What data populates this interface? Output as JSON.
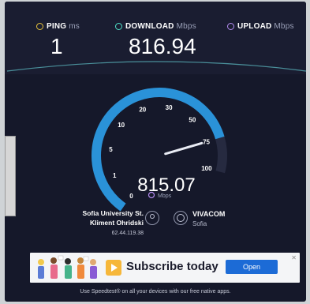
{
  "metrics": {
    "ping": {
      "label": "PING",
      "unit": "ms",
      "value": "1"
    },
    "download": {
      "label": "DOWNLOAD",
      "unit": "Mbps",
      "value": "816.94"
    },
    "upload": {
      "label": "UPLOAD",
      "unit": "Mbps",
      "value": ""
    }
  },
  "gauge": {
    "ticks": [
      "0",
      "1",
      "5",
      "10",
      "20",
      "30",
      "50",
      "75",
      "100"
    ],
    "current": "815.07",
    "unit": "Mbps",
    "needle_value": 75
  },
  "server": {
    "isp_line1": "Sofia University St.",
    "isp_line2": "Kliment Ohridski",
    "ip": "62.44.119.38",
    "name": "VIVACOM",
    "city": "Sofia"
  },
  "ad": {
    "text": "Subscribe today",
    "button": "Open",
    "close": "✕"
  },
  "footer": "Use Speedtest® on all your devices with our free native apps.",
  "colors": {
    "ping_accent": "#e6c23c",
    "download_accent": "#4fe0c8",
    "upload_accent": "#b48cf0",
    "gauge_arc": "#2a92d8",
    "background": "#15182a",
    "ad_button": "#1c6bd6"
  }
}
